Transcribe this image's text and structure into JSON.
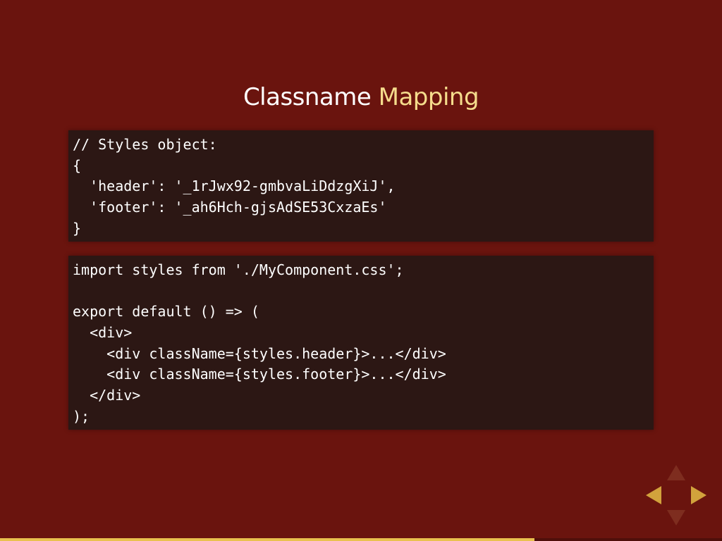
{
  "slide": {
    "title_main": "Classname",
    "title_accent": "Mapping"
  },
  "code_blocks": [
    {
      "lines": [
        "// Styles object:",
        "{",
        "  'header': '_1rJwx92-gmbvaLiDdzgXiJ',",
        "  'footer': '_ah6Hch-gjsAdSE53CxzaEs'",
        "}"
      ]
    },
    {
      "lines": [
        "import styles from './MyComponent.css';",
        "",
        "export default () => (",
        "  <div>",
        "    <div className={styles.header}>...</div>",
        "    <div className={styles.footer}>...</div>",
        "  </div>",
        ");"
      ]
    }
  ],
  "controls": {
    "up_icon": "arrow-up-icon",
    "down_icon": "arrow-down-icon",
    "left_icon": "arrow-left-icon",
    "right_icon": "arrow-right-icon",
    "active_color": "#d2a23c",
    "inactive_color": "#7e2d1f"
  },
  "progress": {
    "fraction": 0.74,
    "color": "#e9c14e"
  },
  "colors": {
    "background": "#6a140e",
    "code_background": "#2c1714",
    "title_accent": "#f5dc8c"
  }
}
